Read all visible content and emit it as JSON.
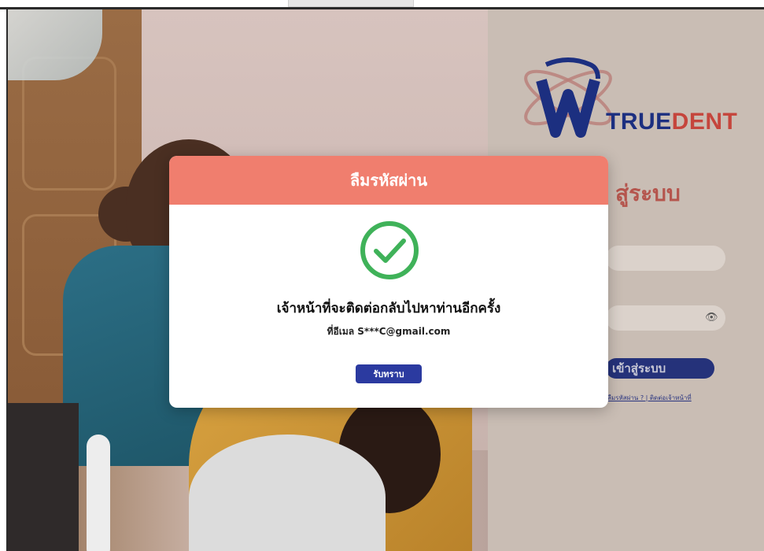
{
  "brand": {
    "name_part1": "TRUE",
    "name_part2": "DENT",
    "primary_color": "#1c2f80",
    "secondary_color": "#c5453c"
  },
  "login": {
    "title_partial": "สู่ระบบ",
    "login_button_partial": "เข้าสู่ระบบ",
    "links_partial": "ลืมรหัสผ่าน ? | ติดต่อเจ้าหน้าที่",
    "password_toggle_icon": "eye-icon"
  },
  "modal": {
    "title": "ลืมรหัสผ่าน",
    "header_color": "#f07e6e",
    "icon": "check-circle-icon",
    "icon_color": "#3fb259",
    "message": "เจ้าหน้าที่จะติดต่อกลับไปหาท่านอีกครั้ง",
    "sub_message": "ที่อีเมล S***C@gmail.com",
    "confirm_label": "รับทราบ",
    "confirm_color": "#2b3aa0"
  }
}
